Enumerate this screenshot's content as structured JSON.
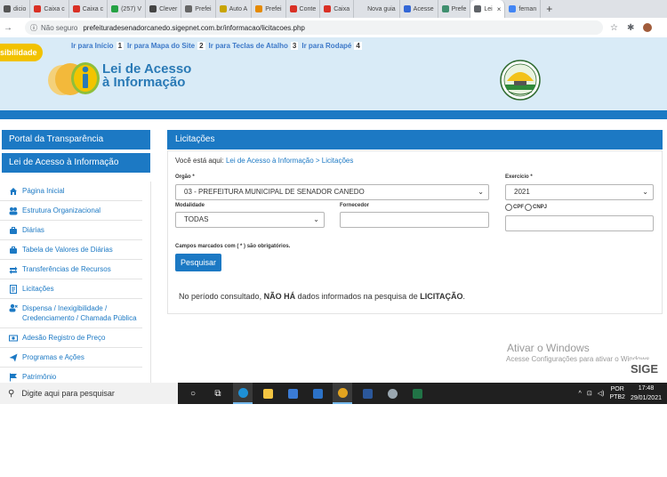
{
  "browser": {
    "tabs": [
      {
        "label": "dicio",
        "color": "#555"
      },
      {
        "label": "Caixa c",
        "color": "#d93025"
      },
      {
        "label": "Caixa c",
        "color": "#d93025"
      },
      {
        "label": "(257) V",
        "color": "#25a244"
      },
      {
        "label": "Clever",
        "color": "#444"
      },
      {
        "label": "Prefei",
        "color": "#666"
      },
      {
        "label": "Auto A",
        "color": "#c8a400"
      },
      {
        "label": "Prefei",
        "color": "#e58a00"
      },
      {
        "label": "Conte",
        "color": "#d93025"
      },
      {
        "label": "Caixa",
        "color": "#d93025"
      },
      {
        "label": "Nova guia",
        "color": "#dee1e6"
      },
      {
        "label": "Acesse",
        "color": "#3367d6"
      },
      {
        "label": "Prefe",
        "color": "#3f8f6f"
      },
      {
        "label": "Lei",
        "color": "#5f6368",
        "active": true
      },
      {
        "label": "fernan",
        "color": "#4285f4"
      }
    ],
    "new_tab": "+",
    "not_secure": "Não seguro",
    "url": "prefeituradesenadorcanedo.sigepnet.com.br/informacao/licitacoes.php"
  },
  "header": {
    "accessibility": "sibilidade",
    "skip_links": [
      {
        "label": "Ir para Início",
        "key": "1"
      },
      {
        "label": "Ir para Mapa do Site",
        "key": "2"
      },
      {
        "label": "Ir para Teclas de Atalho",
        "key": "3"
      },
      {
        "label": "Ir para Rodapé",
        "key": "4"
      }
    ],
    "logo_line1": "Lei de Acesso",
    "logo_line2": "à Informação"
  },
  "sidebar": {
    "portal": "Portal da Transparência",
    "lei": "Lei de Acesso à Informação",
    "items": [
      {
        "label": "Página Inicial",
        "icon": "home-icon"
      },
      {
        "label": "Estrutura Organizacional",
        "icon": "users-icon"
      },
      {
        "label": "Diárias",
        "icon": "briefcase-icon"
      },
      {
        "label": "Tabela de Valores de Diárias",
        "icon": "briefcase-icon"
      },
      {
        "label": "Transferências de Recursos",
        "icon": "transfer-icon"
      },
      {
        "label": "Licitações",
        "icon": "document-icon"
      },
      {
        "label": "Dispensa / Inexigibilidade / Credenciamento / Chamada Pública",
        "icon": "user-x-icon"
      },
      {
        "label": "Adesão Registro de Preço",
        "icon": "money-icon"
      },
      {
        "label": "Programas e Ações",
        "icon": "send-icon"
      },
      {
        "label": "Patrimônio",
        "icon": "flag-icon"
      }
    ]
  },
  "main": {
    "title": "Licitações",
    "breadcrumb_prefix": "Você está aqui:",
    "breadcrumb_path": "Lei de Acesso à Informação > Licitações",
    "orgao_label": "Orgão *",
    "orgao_value": "03 - PREFEITURA MUNICIPAL DE SENADOR CANEDO",
    "exercicio_label": "Exercício *",
    "exercicio_value": "2021",
    "modalidade_label": "Modalidade",
    "modalidade_value": "TODAS",
    "fornecedor_label": "Fornecedor",
    "fornecedor_value": "",
    "cpf": "CPF",
    "cnpj": "CNPJ",
    "required_note": "Campos marcados com ( * ) são obrigatórios.",
    "search_button": "Pesquisar",
    "result_1": "No período consultado,",
    "result_2": "NÃO HÁ",
    "result_3": "dados informados na pesquisa de",
    "result_4": "LICITAÇÃO",
    "result_5": "."
  },
  "watermark": {
    "line1": "Ativar o Windows",
    "line2": "Acesse Configurações para ativar o Windows.",
    "brand": "SIGE"
  },
  "taskbar": {
    "search_placeholder": "Digite aqui para pesquisar",
    "lang1": "POR",
    "lang2": "PTB2",
    "time": "17:48",
    "date": "29/01/2021"
  }
}
